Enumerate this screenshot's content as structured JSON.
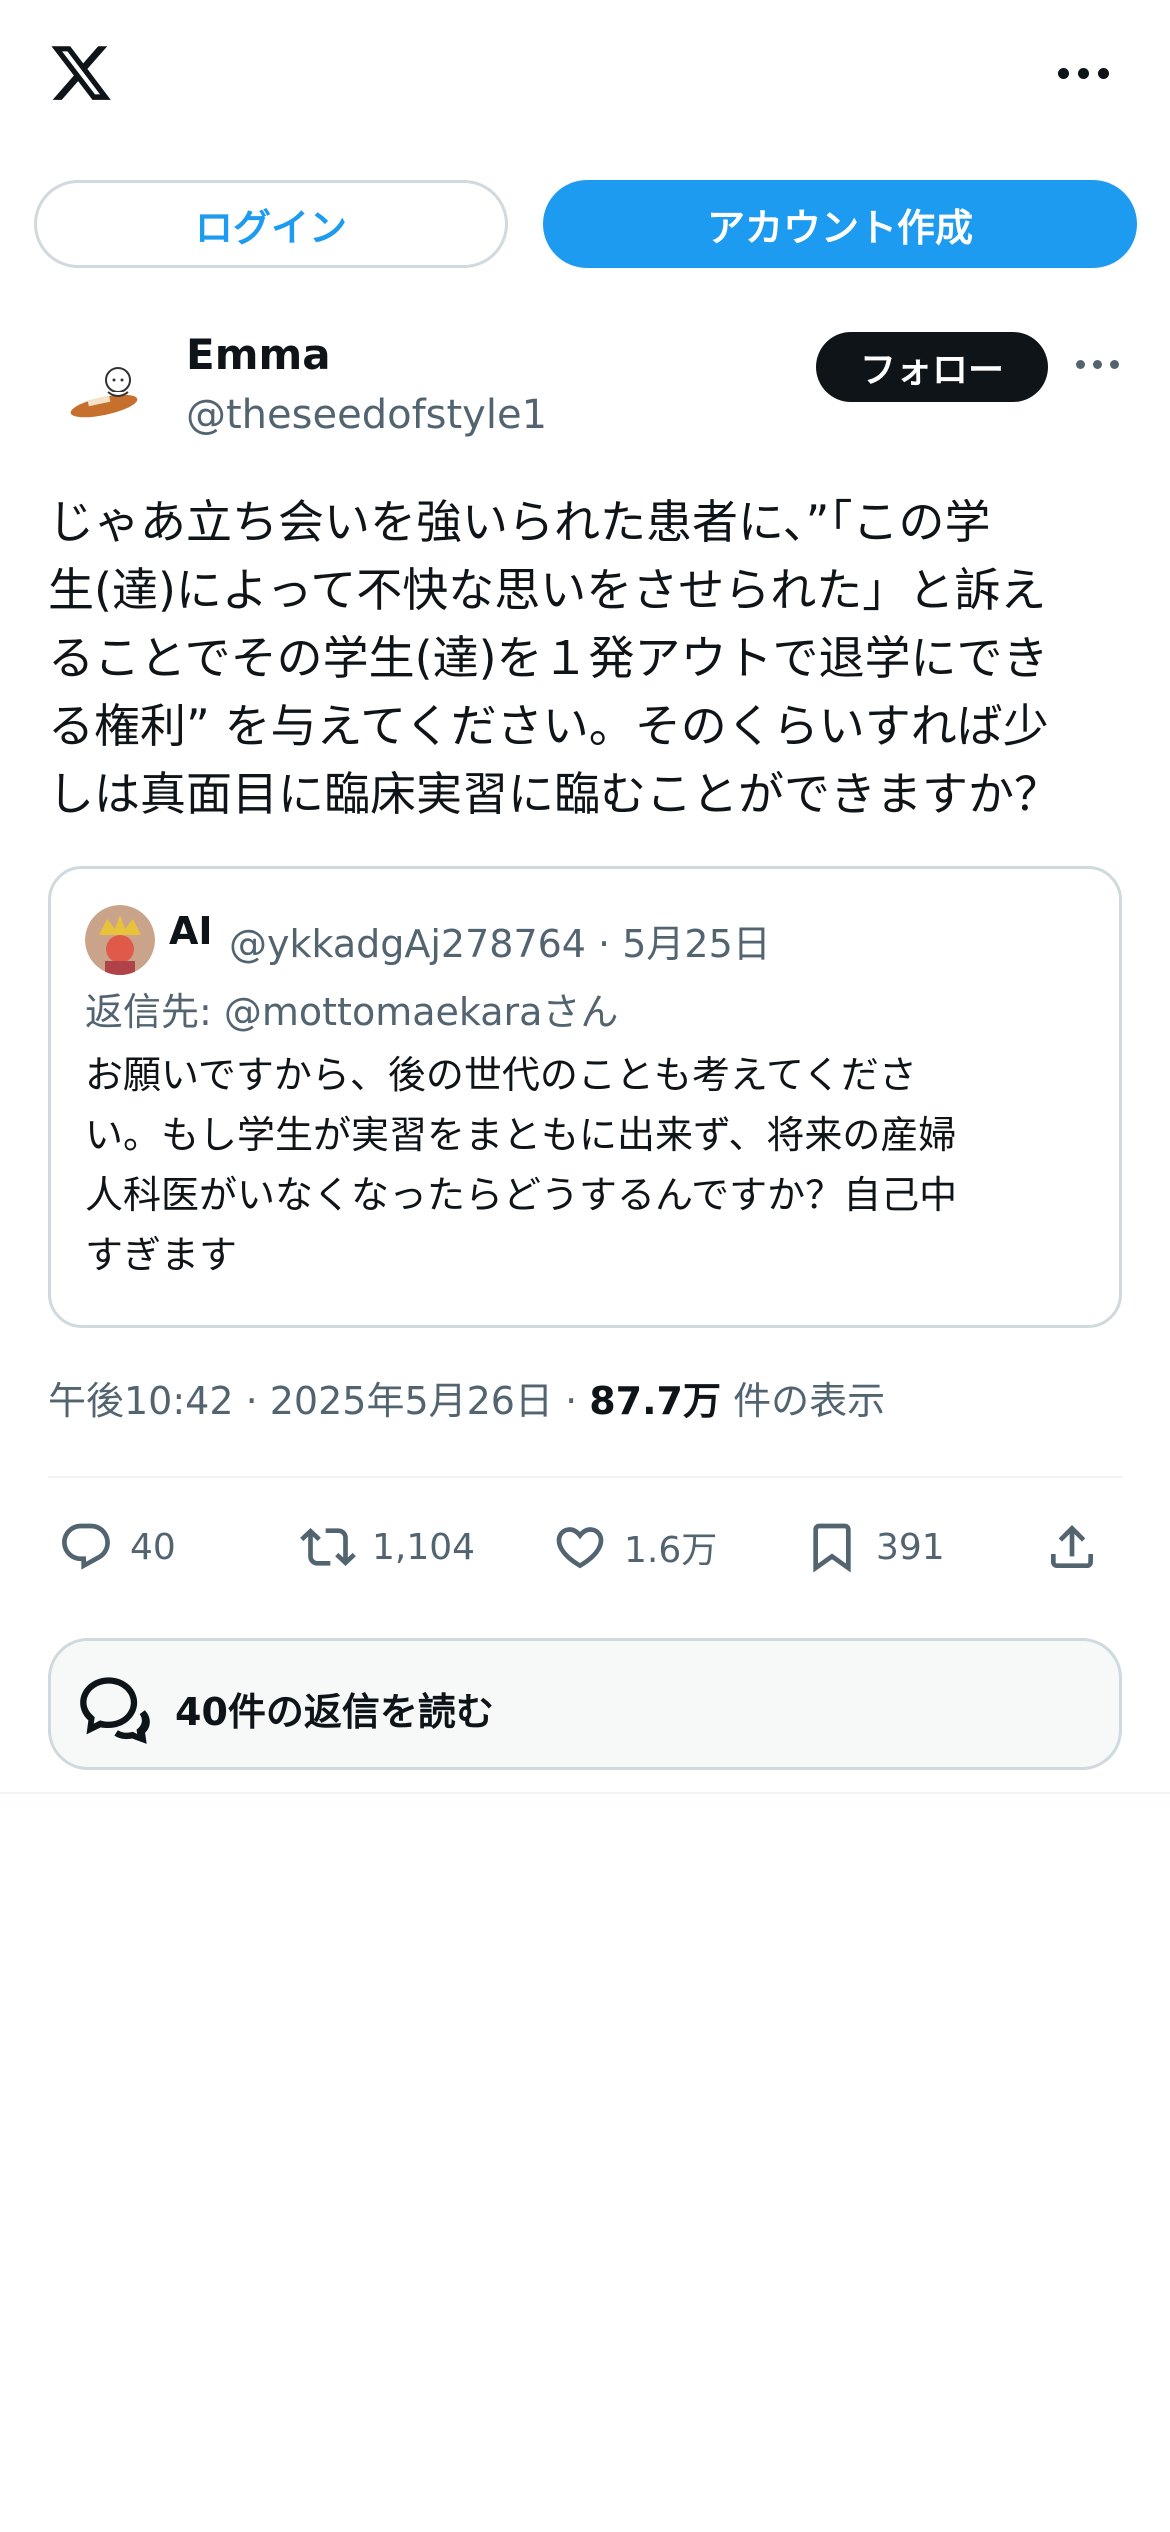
{
  "header": {
    "login_label": "ログイン",
    "signup_label": "アカウント作成"
  },
  "author": {
    "name": "Emma",
    "handle": "@theseedofstyle1",
    "follow_label": "フォロー"
  },
  "tweet": {
    "text": "じゃあ立ち会いを強いられた患者に、”「この学\n生(達)によって不快な思いをさせられた」と訴え\nることでその学生(達)を１発アウトで退学にでき\nる権利” を与えてください。そのくらいすれば少\nしは真面目に臨床実習に臨むことができますか？",
    "time": "午後10:42 · 2025年5月26日 · ",
    "views": "87.7万",
    "views_suffix": " 件の表示"
  },
  "quoted": {
    "name": "AI",
    "meta": "@ykkadgAj278764 · 5月25日",
    "reply_to": "返信先: @mottomaekaraさん",
    "text": "お願いですから、後の世代のことも考えてくださ\nい。もし学生が実習をまともに出来ず、将来の産婦\n人科医がいなくなったらどうするんですか？自己中\nすぎます"
  },
  "actions": {
    "replies": "40",
    "retweets": "1,104",
    "likes": "1.6万",
    "bookmarks": "391"
  },
  "read_replies_label": "40件の返信を読む",
  "colors": {
    "accent": "#1d9bf0",
    "text": "#0f1419",
    "secondary": "#536471",
    "border": "#cfd9de"
  }
}
